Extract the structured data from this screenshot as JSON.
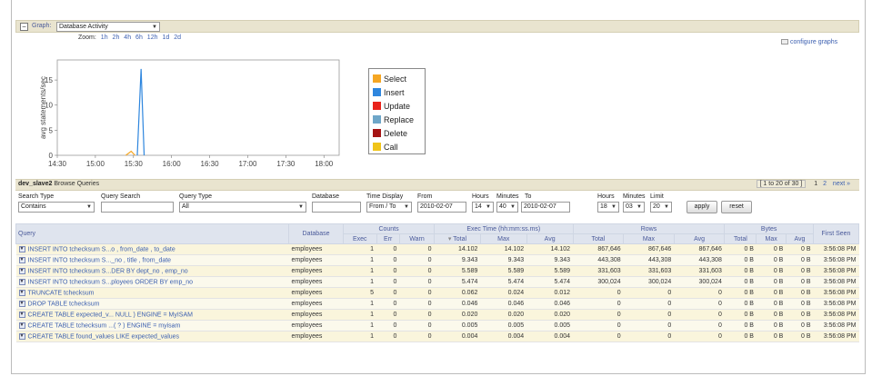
{
  "graph": {
    "label": "Graph:",
    "selected": "Database Activity",
    "zoom_label": "Zoom:",
    "zoom_options": [
      "1h",
      "2h",
      "4h",
      "6h",
      "12h",
      "1d",
      "2d"
    ],
    "configure_label": "configure graphs"
  },
  "chart_data": {
    "type": "line",
    "ylabel": "avg statements/sec",
    "y_ticks": [
      "0",
      "5",
      "10",
      "15"
    ],
    "x_ticks": [
      "14:30",
      "15:00",
      "15:30",
      "16:00",
      "16:30",
      "17:00",
      "17:30",
      "18:00"
    ],
    "ylim": [
      0,
      19
    ],
    "legend": [
      {
        "name": "Select",
        "color": "#f5a623"
      },
      {
        "name": "Insert",
        "color": "#2e86de"
      },
      {
        "name": "Update",
        "color": "#e8231b"
      },
      {
        "name": "Replace",
        "color": "#6ea6c8"
      },
      {
        "name": "Delete",
        "color": "#a51414"
      },
      {
        "name": "Call",
        "color": "#f0c419"
      }
    ],
    "series": [
      {
        "name": "Insert",
        "color": "#2e86de",
        "points": [
          [
            15.55,
            0
          ],
          [
            15.6,
            17.2
          ],
          [
            15.64,
            0
          ]
        ]
      },
      {
        "name": "Select",
        "color": "#f5a623",
        "points": [
          [
            15.4,
            0
          ],
          [
            15.47,
            0.8
          ],
          [
            15.52,
            0
          ]
        ]
      }
    ]
  },
  "browse": {
    "server": "dev_slave2",
    "title_rest": "Browse Queries",
    "range": "[ 1 to 20 of 30 ]",
    "pages": [
      "1",
      "2"
    ],
    "next": "next »"
  },
  "filters": {
    "search_type_label": "Search Type",
    "search_type_value": "Contains",
    "query_search_label": "Query Search",
    "query_type_label": "Query Type",
    "query_type_value": "All",
    "database_label": "Database",
    "time_display_label": "Time Display",
    "time_display_value": "From / To",
    "from_label": "From",
    "from_value": "2010-02-07",
    "hours_label": "Hours",
    "hours_from": "14",
    "minutes_label": "Minutes",
    "minutes_from": "40",
    "to_label": "To",
    "to_value": "2010-02-07",
    "hours_to": "18",
    "minutes_to": "03",
    "limit_label": "Limit",
    "limit_value": "20",
    "apply": "apply",
    "reset": "reset"
  },
  "table": {
    "headers": {
      "query": "Query",
      "database": "Database",
      "counts": "Counts",
      "exec_time": "Exec Time (hh:mm:ss.ms)",
      "rows": "Rows",
      "bytes": "Bytes",
      "first_seen": "First Seen",
      "exec": "Exec",
      "err": "Err",
      "warn": "Warn",
      "total": "Total",
      "max": "Max",
      "avg": "Avg",
      "rows_total": "Total",
      "rows_max": "Max",
      "rows_avg": "Avg",
      "bytes_total": "Total",
      "bytes_max": "Max",
      "bytes_avg": "Avg"
    },
    "rows": [
      [
        "INSERT INTO tchecksum S...o , from_date , to_date",
        "employees",
        "1",
        "0",
        "0",
        "14.102",
        "14.102",
        "14.102",
        "867,646",
        "867,646",
        "867,646",
        "0 B",
        "0 B",
        "0 B",
        "3:56:08 PM"
      ],
      [
        "INSERT INTO tchecksum S..._no , title , from_date",
        "employees",
        "1",
        "0",
        "0",
        "9.343",
        "9.343",
        "9.343",
        "443,308",
        "443,308",
        "443,308",
        "0 B",
        "0 B",
        "0 B",
        "3:56:08 PM"
      ],
      [
        "INSERT INTO tchecksum S...DER BY dept_no , emp_no",
        "employees",
        "1",
        "0",
        "0",
        "5.589",
        "5.589",
        "5.589",
        "331,603",
        "331,603",
        "331,603",
        "0 B",
        "0 B",
        "0 B",
        "3:56:08 PM"
      ],
      [
        "INSERT INTO tchecksum S...ployees ORDER BY emp_no",
        "employees",
        "1",
        "0",
        "0",
        "5.474",
        "5.474",
        "5.474",
        "300,024",
        "300,024",
        "300,024",
        "0 B",
        "0 B",
        "0 B",
        "3:56:08 PM"
      ],
      [
        "TRUNCATE tchecksum",
        "employees",
        "5",
        "0",
        "0",
        "0.062",
        "0.024",
        "0.012",
        "0",
        "0",
        "0",
        "0 B",
        "0 B",
        "0 B",
        "3:56:08 PM"
      ],
      [
        "DROP TABLE tchecksum",
        "employees",
        "1",
        "0",
        "0",
        "0.046",
        "0.046",
        "0.046",
        "0",
        "0",
        "0",
        "0 B",
        "0 B",
        "0 B",
        "3:56:08 PM"
      ],
      [
        "CREATE TABLE expected_v... NULL ) ENGINE = MyISAM",
        "employees",
        "1",
        "0",
        "0",
        "0.020",
        "0.020",
        "0.020",
        "0",
        "0",
        "0",
        "0 B",
        "0 B",
        "0 B",
        "3:56:08 PM"
      ],
      [
        "CREATE TABLE tchecksum ...( ? ) ENGINE = myisam",
        "employees",
        "1",
        "0",
        "0",
        "0.005",
        "0.005",
        "0.005",
        "0",
        "0",
        "0",
        "0 B",
        "0 B",
        "0 B",
        "3:56:08 PM"
      ],
      [
        "CREATE TABLE found_values LIKE expected_values",
        "employees",
        "1",
        "0",
        "0",
        "0.004",
        "0.004",
        "0.004",
        "0",
        "0",
        "0",
        "0 B",
        "0 B",
        "0 B",
        "3:56:08 PM"
      ]
    ]
  }
}
